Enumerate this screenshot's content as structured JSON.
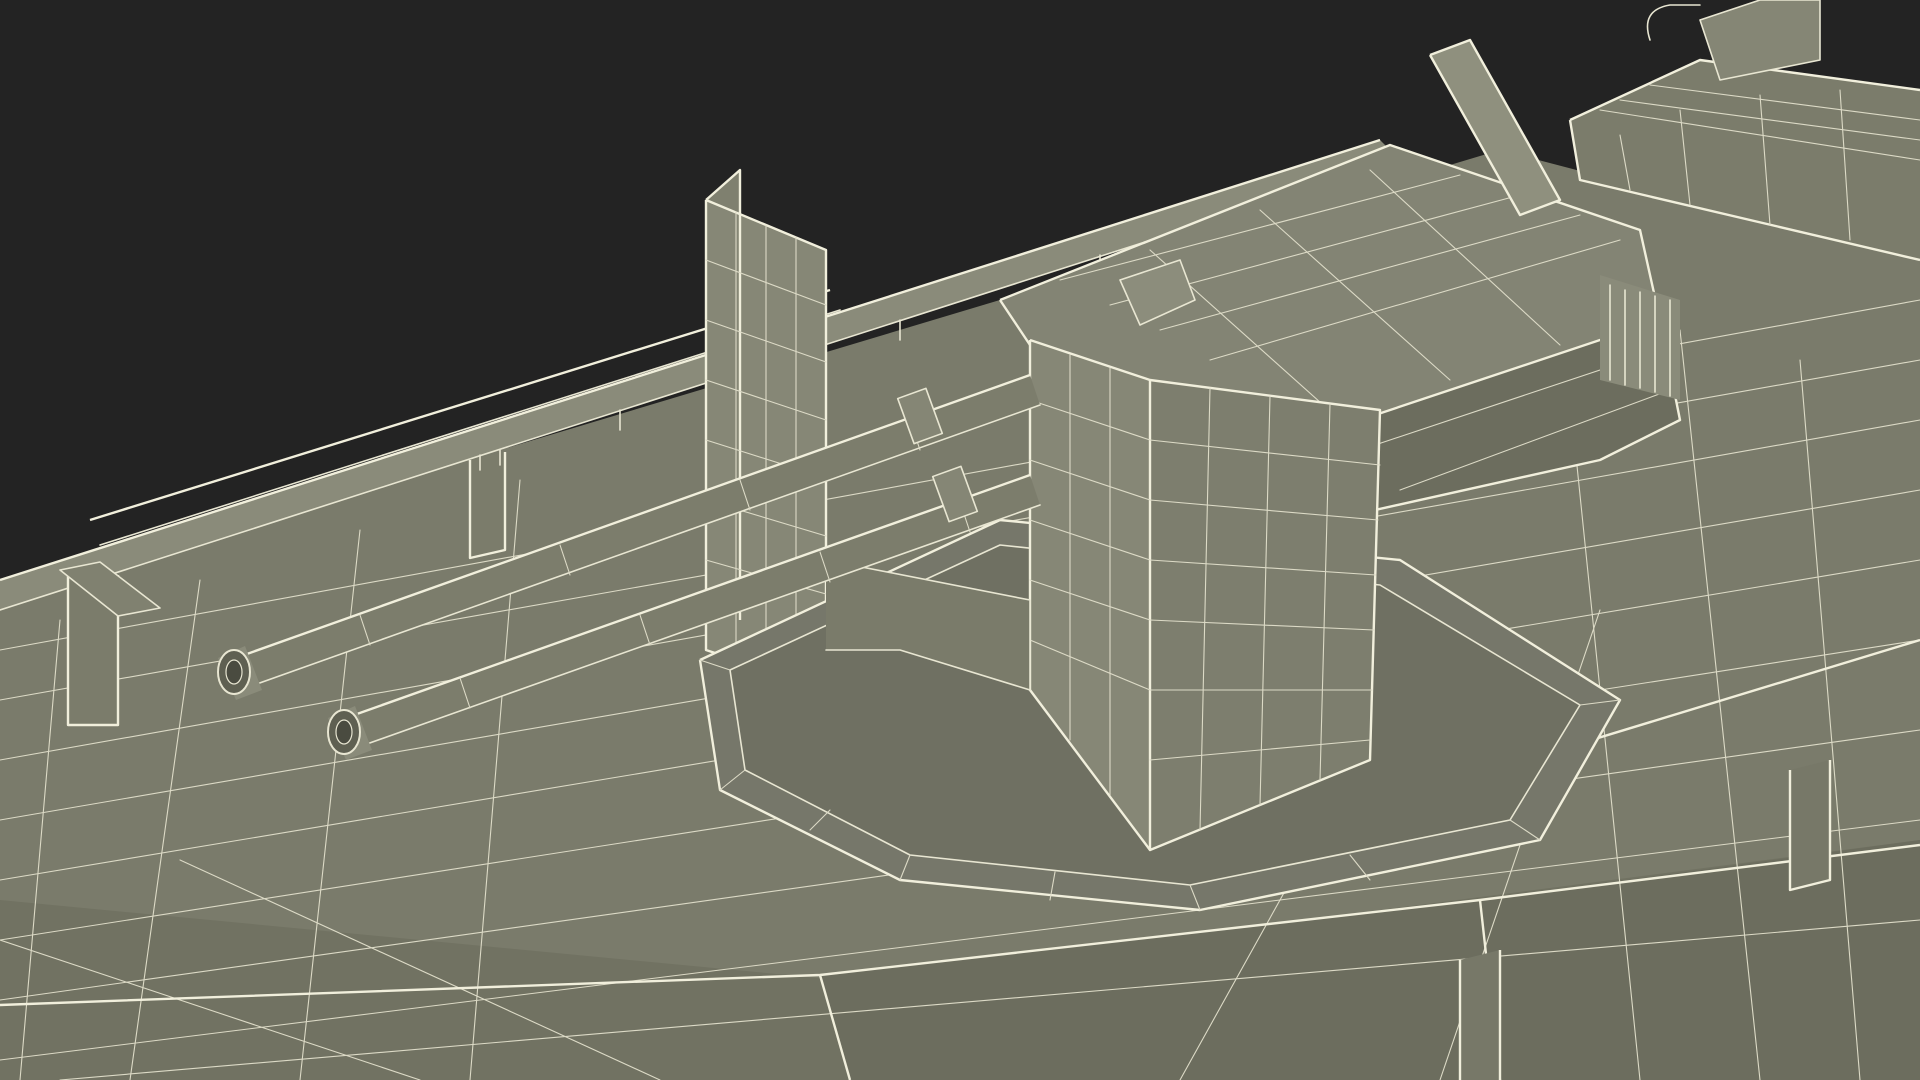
{
  "scene": {
    "subject": "twin-barrel-deck-gun-wireframe",
    "colors": {
      "background": "#232323",
      "deck": "#7a7b6b",
      "deck_dark": "#6a6b5c",
      "turret": "#7d7e6e",
      "turret_shade": "#6c6d5e",
      "barrel": "#787967",
      "wire": "#e8e6d2"
    }
  }
}
